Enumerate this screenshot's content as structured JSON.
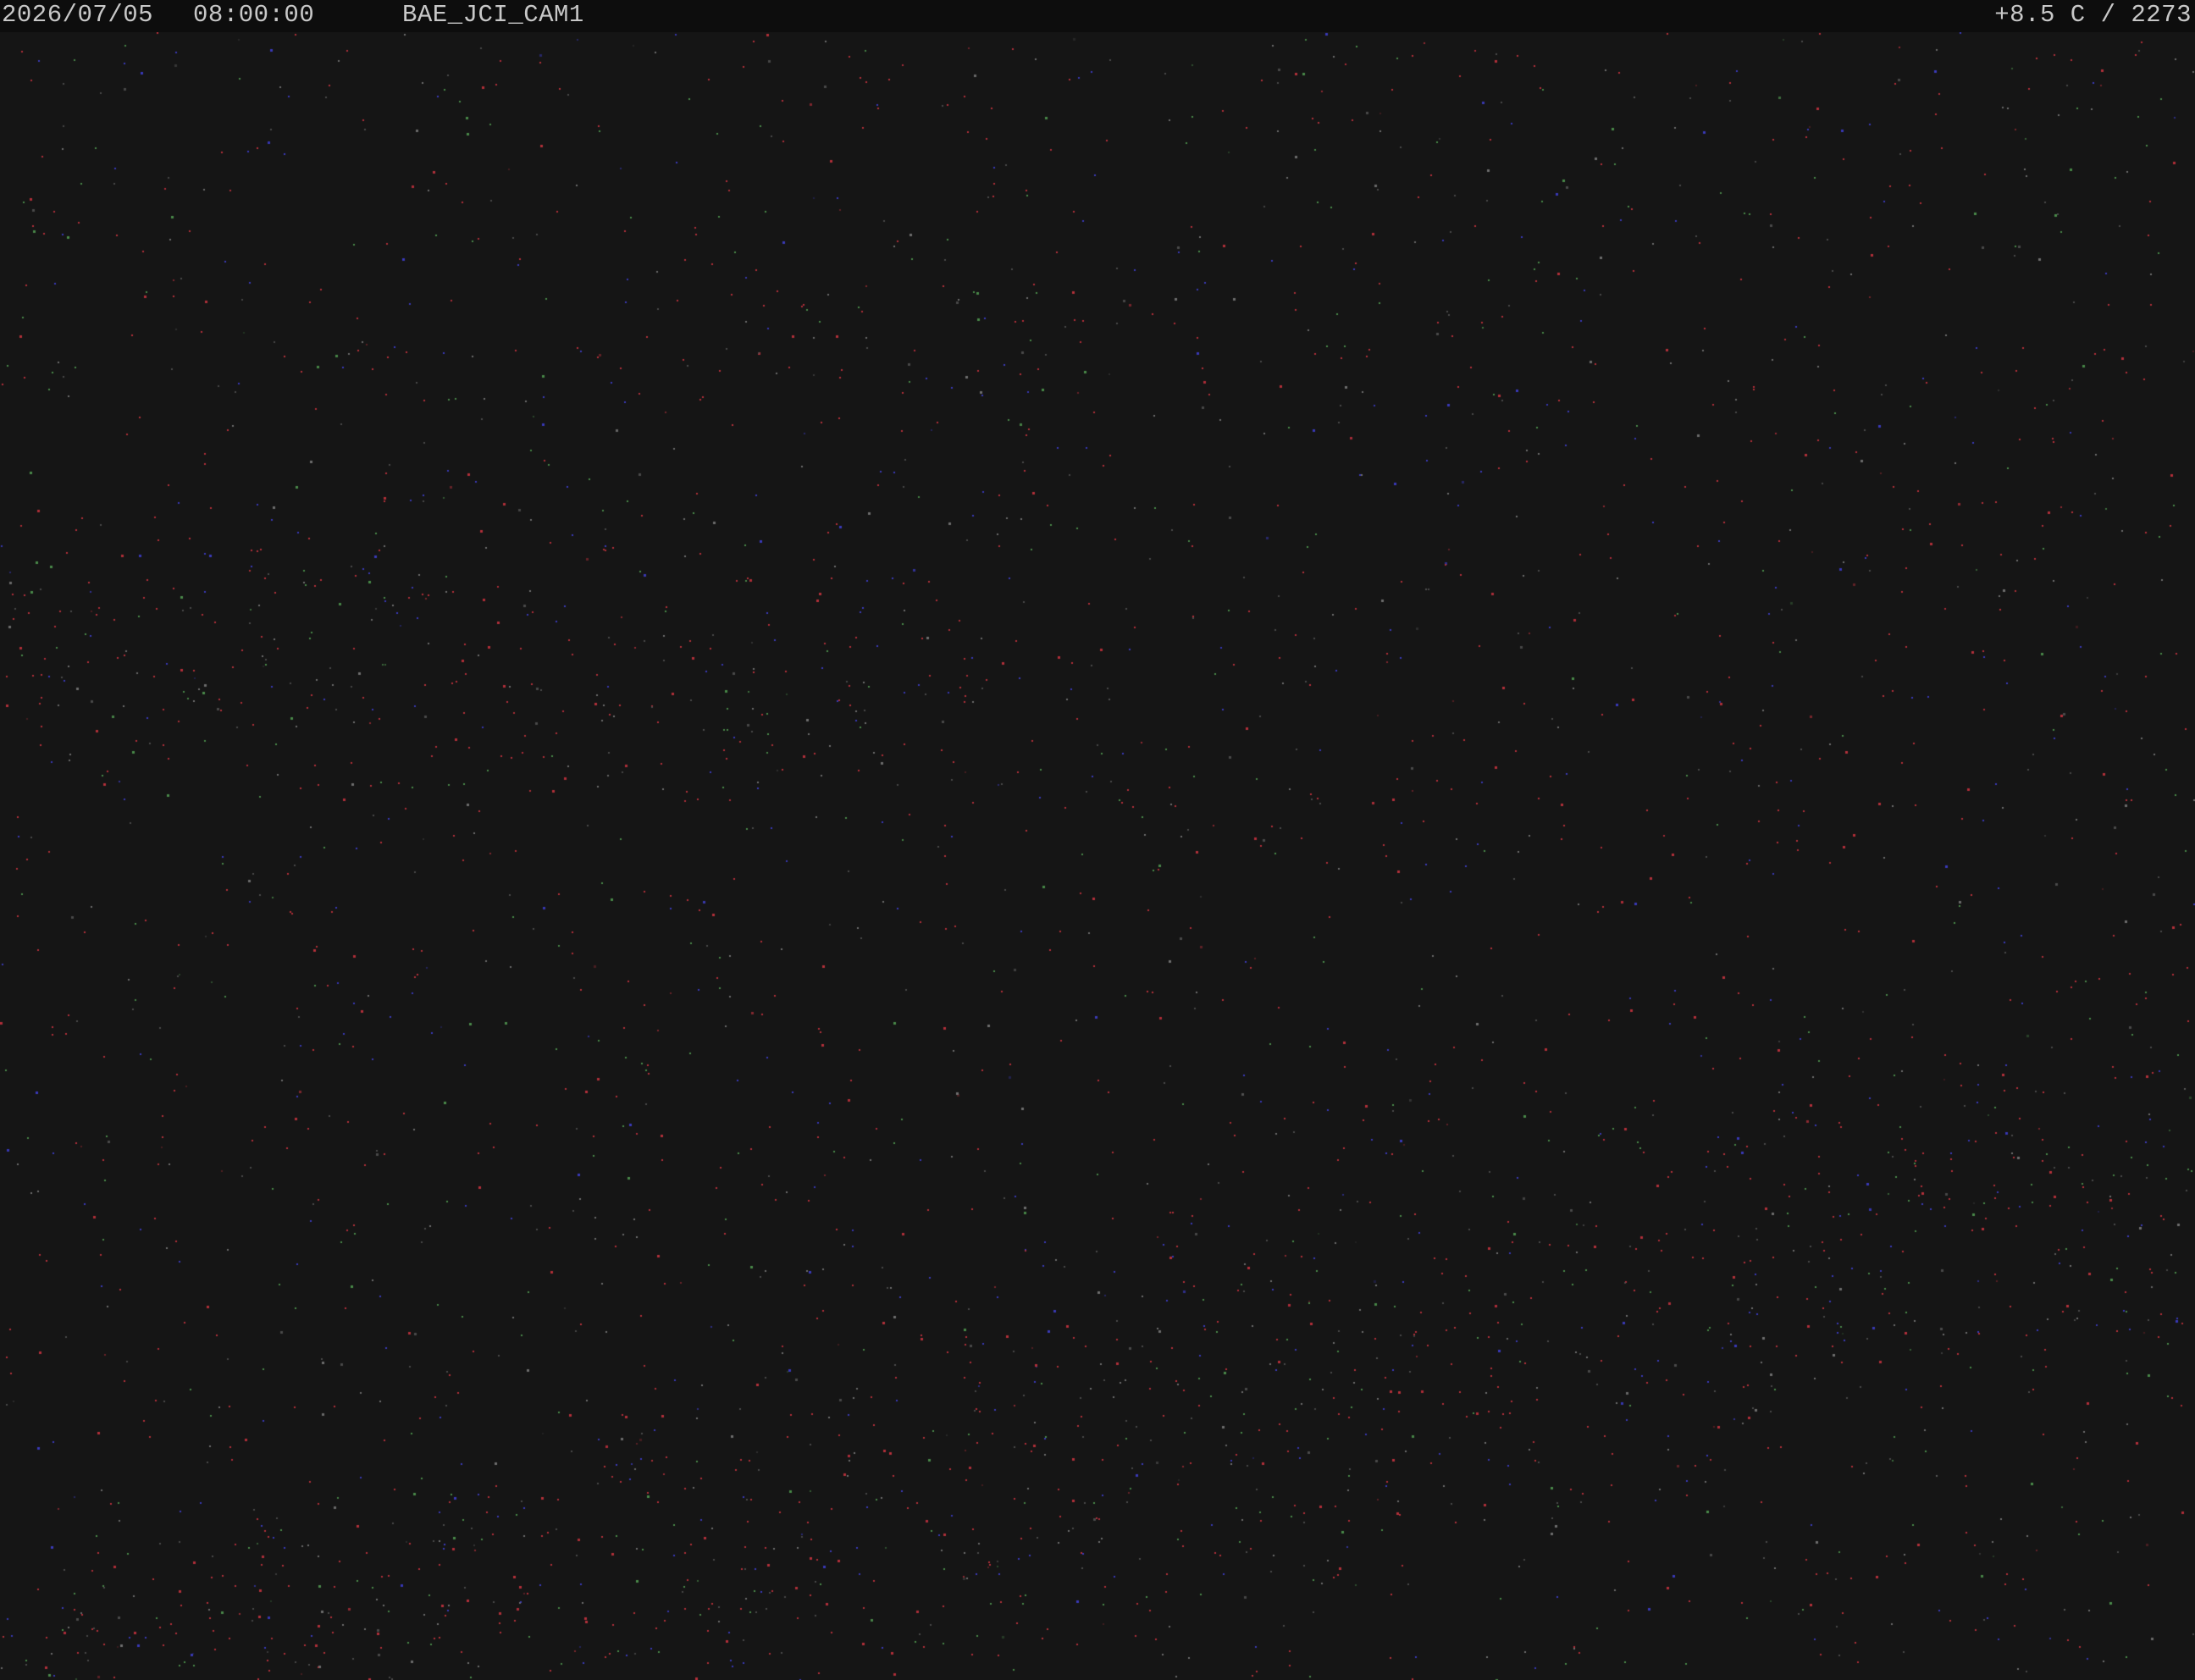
{
  "overlay": {
    "date": "2026/07/05",
    "time": "08:00:00",
    "camera_id": "BAE_JCI_CAM1",
    "telemetry": "+8.5 C / 2273"
  },
  "colors": {
    "background": "#151515",
    "overlay_bar": "#0d0d0d",
    "overlay_text": "#c8c8c8",
    "noise_red": "#b2303a",
    "noise_blue": "#3a3ab8",
    "noise_green": "#4a8a4a"
  }
}
